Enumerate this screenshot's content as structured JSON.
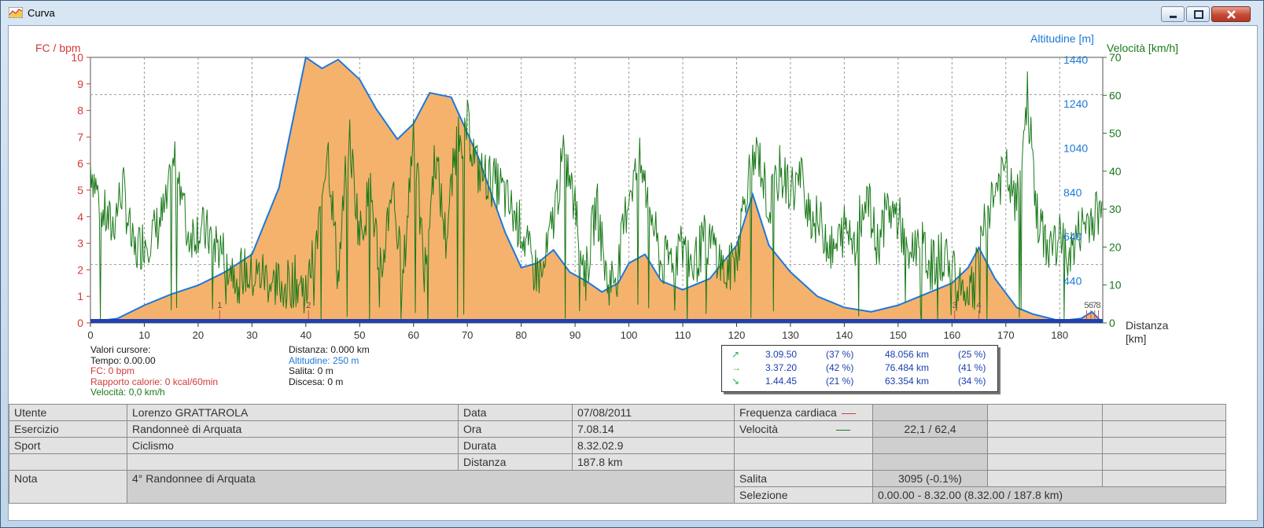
{
  "window": {
    "title": "Curva"
  },
  "colors": {
    "altitude_fill": "#f5b26d",
    "altitude_line": "#1c77dc",
    "speed_line": "#1a7a1a",
    "fc_axis": "#d23a3a",
    "distance_bar": "#2040b0"
  },
  "chart_data": {
    "type": "area",
    "axes": {
      "left_title": "FC / bpm",
      "left_ticks": [
        "10",
        "9",
        "8",
        "7",
        "6",
        "5",
        "4",
        "3",
        "2",
        "1",
        "0"
      ],
      "alt_title": "Altitudine [m]",
      "alt_ticks": [
        "1440",
        "1240",
        "1040",
        "840",
        "640",
        "440"
      ],
      "speed_title": "Velocità [km/h]",
      "speed_ticks": [
        "70",
        "60",
        "50",
        "40",
        "30",
        "20",
        "10",
        "0"
      ],
      "x_title_1": "Distanza",
      "x_title_2": "[km]",
      "x_ticks": [
        "0",
        "10",
        "20",
        "30",
        "40",
        "50",
        "60",
        "70",
        "80",
        "90",
        "100",
        "110",
        "120",
        "130",
        "140",
        "150",
        "160",
        "170",
        "180"
      ],
      "xlim": [
        0,
        188
      ],
      "alt_ylim": [
        250,
        1450
      ],
      "speed_ylim": [
        0,
        70
      ],
      "grid": true
    },
    "series": [
      {
        "name": "Altitudine",
        "x": [
          0,
          5,
          10,
          15,
          20,
          25,
          30,
          35,
          40,
          43,
          46,
          50,
          53,
          57,
          60,
          63,
          67,
          72,
          77,
          80,
          83,
          86,
          89,
          92,
          95,
          98,
          100,
          103,
          106,
          110,
          115,
          120,
          123,
          126,
          130,
          135,
          140,
          145,
          150,
          155,
          160,
          163,
          165,
          168,
          172,
          175,
          180,
          184,
          186,
          188
        ],
        "y": [
          255,
          270,
          330,
          380,
          420,
          480,
          560,
          860,
          1450,
          1400,
          1440,
          1350,
          1220,
          1080,
          1150,
          1290,
          1270,
          1000,
          660,
          500,
          520,
          580,
          480,
          440,
          390,
          430,
          520,
          560,
          440,
          400,
          450,
          600,
          830,
          600,
          480,
          370,
          320,
          300,
          330,
          380,
          430,
          500,
          590,
          450,
          320,
          290,
          260,
          270,
          300,
          250
        ]
      },
      {
        "name": "Velocità",
        "x": [
          0,
          2,
          4,
          6,
          8,
          10,
          12,
          14,
          16,
          18,
          20,
          22,
          24,
          26,
          28,
          30,
          32,
          34,
          36,
          38,
          40,
          42,
          44,
          46,
          48,
          50,
          52,
          54,
          56,
          58,
          60,
          62,
          64,
          66,
          68,
          70,
          72,
          74,
          76,
          78,
          80,
          82,
          84,
          86,
          88,
          90,
          92,
          94,
          96,
          98,
          100,
          102,
          104,
          106,
          108,
          110,
          112,
          114,
          116,
          118,
          120,
          122,
          124,
          126,
          128,
          130,
          132,
          134,
          136,
          138,
          140,
          142,
          144,
          146,
          148,
          150,
          152,
          154,
          156,
          158,
          160,
          162,
          164,
          166,
          168,
          170,
          172,
          174,
          176,
          178,
          180,
          182,
          184,
          186,
          188
        ],
        "y": [
          42,
          30,
          25,
          36,
          18,
          22,
          24,
          30,
          45,
          23,
          25,
          23,
          20,
          15,
          14,
          12,
          13,
          10,
          10,
          11,
          9,
          20,
          48,
          12,
          50,
          23,
          35,
          12,
          38,
          10,
          52,
          12,
          45,
          22,
          48,
          52,
          40,
          38,
          36,
          30,
          25,
          15,
          12,
          28,
          45,
          30,
          12,
          32,
          10,
          14,
          35,
          42,
          30,
          15,
          18,
          20,
          15,
          22,
          20,
          12,
          18,
          38,
          45,
          30,
          40,
          35,
          38,
          28,
          25,
          18,
          25,
          22,
          35,
          20,
          30,
          28,
          18,
          22,
          15,
          18,
          16,
          10,
          8,
          28,
          35,
          40,
          30,
          60,
          25,
          20,
          22,
          18,
          25,
          28,
          30
        ]
      }
    ],
    "markers": [
      "1",
      "2",
      "3",
      "4",
      "5",
      "6",
      "7",
      "8"
    ],
    "markers_x": [
      24,
      40.5,
      160.5,
      165,
      185,
      185.8,
      186.5,
      187.2
    ]
  },
  "cursor": {
    "title": "Valori cursore:",
    "tempo": "Tempo: 0.00.00",
    "fc": "FC: 0 bpm",
    "calorie": "Rapporto calorie: 0 kcal/60min",
    "velocita": "Velocità: 0,0 km/h",
    "distanza": "Distanza: 0.000 km",
    "altitudine": "Altitudine: 250 m",
    "salita": "Salita: 0 m",
    "discesa": "Discesa: 0 m"
  },
  "stats": [
    {
      "arrow": "↗",
      "time": "3.09.50",
      "pct1": "(37 %)",
      "dist": "48.056 km",
      "pct2": "(25 %)"
    },
    {
      "arrow": "→",
      "time": "3.37.20",
      "pct1": "(42 %)",
      "dist": "76.484 km",
      "pct2": "(41 %)"
    },
    {
      "arrow": "↘",
      "time": "1.44.45",
      "pct1": "(21 %)",
      "dist": "63.354 km",
      "pct2": "(34 %)"
    }
  ],
  "info": {
    "utente_label": "Utente",
    "utente": "Lorenzo  GRATTAROLA",
    "esercizio_label": "Esercizio",
    "esercizio": "Randonneè di Arquata",
    "sport_label": "Sport",
    "sport": "Ciclismo",
    "nota_label": "Nota",
    "nota": "4° Randonnee di Arquata",
    "data_label": "Data",
    "data": "07/08/2011",
    "ora_label": "Ora",
    "ora": "7.08.14",
    "durata_label": "Durata",
    "durata": "8.32.02.9",
    "distanza_label": "Distanza",
    "distanza": "187.8 km",
    "fc_label": "Frequenza cardiaca",
    "vel_label": "Velocità",
    "vel": "22,1 / 62,4",
    "salita_label": "Salita",
    "salita": "3095 (-0.1%)",
    "selezione_label": "Selezione",
    "selezione": "0.00.00 - 8.32.00 (8.32.00 / 187.8 km)"
  }
}
